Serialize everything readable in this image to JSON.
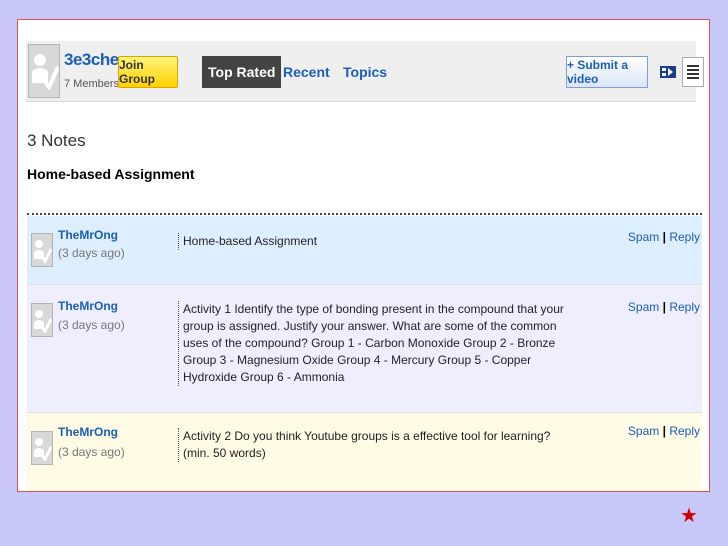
{
  "group": {
    "name": "3e3chem",
    "members": "7 Members",
    "join_label": "Join Group"
  },
  "tabs": [
    {
      "label": "Top Rated",
      "active": true
    },
    {
      "label": "Recent",
      "active": false
    },
    {
      "label": "Topics",
      "active": false
    }
  ],
  "submit_label": "+ Submit a video",
  "view_icons": [
    "list-view-icon",
    "grid-view-icon"
  ],
  "notes": {
    "count": "3 Notes",
    "subtitle": "Home-based Assignment",
    "items": [
      {
        "author": "TheMrOng",
        "time": "(3 days ago)",
        "text": "Home-based Assignment",
        "spam": "Spam",
        "reply": "Reply",
        "bg": "#ddeeff"
      },
      {
        "author": "TheMrOng",
        "time": "(3 days ago)",
        "text": "Activity 1 Identify the type of bonding present in the compound that your group is assigned. Justify your answer. What are some of the common uses of the compound? Group 1 - Carbon Monoxide Group 2 - Bronze Group 3 - Magnesium Oxide Group 4 - Mercury Group 5 - Copper Hydroxide Group 6 - Ammonia",
        "spam": "Spam",
        "reply": "Reply",
        "bg": "#eeeeff"
      },
      {
        "author": "TheMrOng",
        "time": "(3 days ago)",
        "text": "Activity 2 Do you think Youtube groups is a effective tool for learning? (min. 50 words)",
        "spam": "Spam",
        "reply": "Reply",
        "bg": "#fffbe5"
      }
    ]
  },
  "decor": {
    "star": "★"
  },
  "colors": {
    "link": "#1a5fb4",
    "join_button": "#ffd200",
    "page_bg": "#c8c8f8",
    "slide_border": "#e05050"
  }
}
